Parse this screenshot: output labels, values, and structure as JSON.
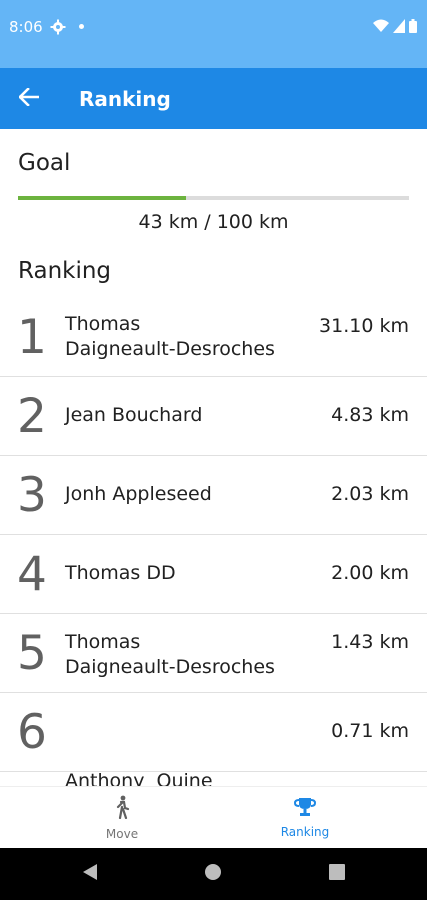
{
  "status_bar": {
    "time": "8:06",
    "icons": [
      "gear-icon",
      "notification-dot-icon",
      "wifi-icon",
      "signal-icon",
      "battery-icon"
    ]
  },
  "app_bar": {
    "title": "Ranking",
    "back_icon": "arrow-back-icon"
  },
  "goal": {
    "title": "Goal",
    "progress_fraction": 0.43,
    "text": "43 km / 100 km"
  },
  "ranking": {
    "title": "Ranking",
    "items": [
      {
        "rank": "1",
        "name_line1": "Thomas",
        "name_line2": "Daigneault-Desroches",
        "distance": "31.10 km"
      },
      {
        "rank": "2",
        "name_line1": "Jean Bouchard",
        "name_line2": "",
        "distance": "4.83 km"
      },
      {
        "rank": "3",
        "name_line1": "Jonh Appleseed",
        "name_line2": "",
        "distance": "2.03 km"
      },
      {
        "rank": "4",
        "name_line1": "Thomas DD",
        "name_line2": "",
        "distance": "2.00 km"
      },
      {
        "rank": "5",
        "name_line1": "Thomas",
        "name_line2": "Daigneault-Desroches",
        "distance": "1.43 km"
      },
      {
        "rank": "6",
        "name_line1": "Anthony  Quine",
        "name_line2": "",
        "distance": "0.71 km"
      }
    ]
  },
  "bottom_nav": {
    "move_label": "Move",
    "ranking_label": "Ranking",
    "active": "Ranking"
  },
  "colors": {
    "status_bar": "#64b5f6",
    "app_bar": "#1e88e5",
    "progress": "#6cb33e",
    "accent": "#1e88e5"
  }
}
